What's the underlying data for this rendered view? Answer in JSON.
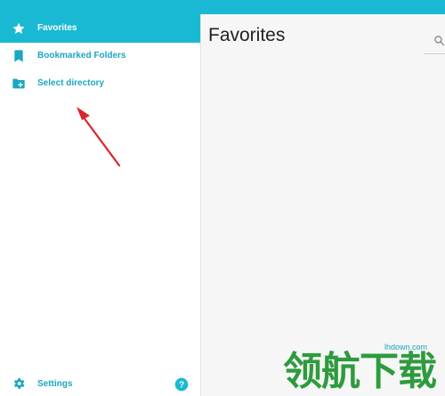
{
  "sidebar": {
    "items": [
      {
        "label": "Favorites",
        "icon": "star-icon",
        "active": true
      },
      {
        "label": "Bookmarked Folders",
        "icon": "bookmark-icon",
        "active": false
      },
      {
        "label": "Select directory",
        "icon": "folder-add-icon",
        "active": false
      }
    ],
    "settings_label": "Settings",
    "help_icon": "help-icon"
  },
  "main": {
    "title": "Favorites",
    "search_icon": "search-icon"
  },
  "watermark": {
    "url": "lhdown.com",
    "brand": "领航下载"
  },
  "colors": {
    "accent": "#1ab9d3",
    "accent_text": "#1aa7c1",
    "arrow": "#d9262c",
    "watermark_green": "#2e9b3e"
  }
}
